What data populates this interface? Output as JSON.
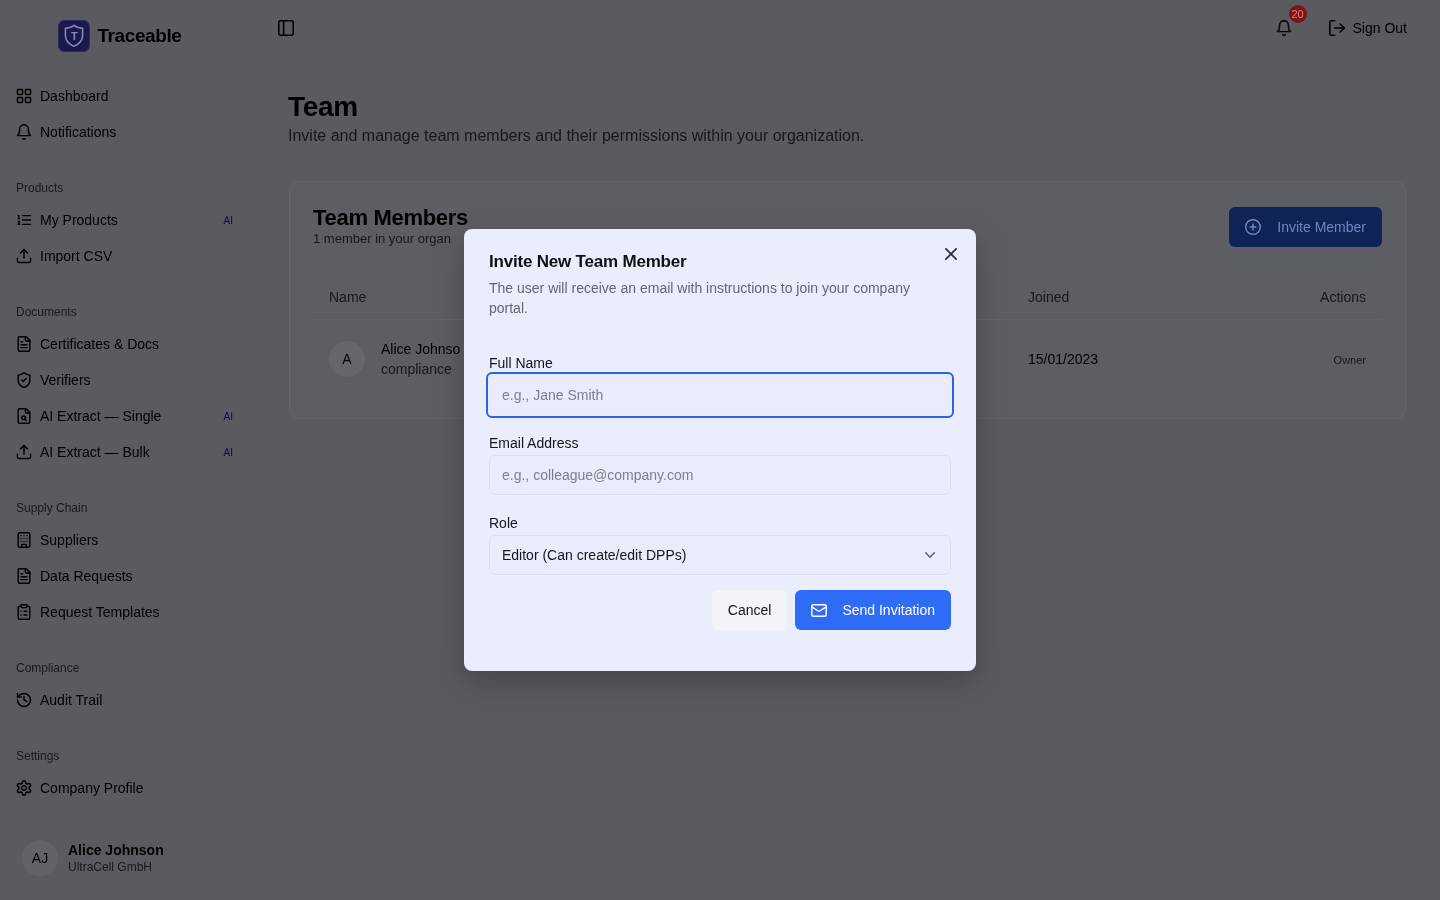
{
  "sidebar": {
    "brand": {
      "mark": "T",
      "name": "Traceable"
    },
    "nav": [
      {
        "label": "Dashboard"
      },
      {
        "label": "Notifications"
      }
    ],
    "sections": [
      {
        "title": "Products",
        "items": [
          {
            "label": "My Products",
            "badge": "AI"
          },
          {
            "label": "Import CSV"
          }
        ]
      },
      {
        "title": "Documents",
        "items": [
          {
            "label": "Certificates & Docs"
          },
          {
            "label": "Verifiers"
          },
          {
            "label": "AI Extract — Single",
            "badge": "AI"
          },
          {
            "label": "AI Extract — Bulk",
            "badge": "AI"
          }
        ]
      },
      {
        "title": "Supply Chain",
        "items": [
          {
            "label": "Suppliers"
          },
          {
            "label": "Data Requests"
          },
          {
            "label": "Request Templates"
          }
        ]
      },
      {
        "title": "Compliance",
        "items": [
          {
            "label": "Audit Trail"
          }
        ]
      },
      {
        "title": "Settings",
        "items": [
          {
            "label": "Company Profile"
          }
        ]
      }
    ],
    "user": {
      "initials": "AJ",
      "name": "Alice Johnson",
      "company": "UltraCell GmbH"
    }
  },
  "topbar": {
    "notification_count": "20",
    "sign_out": "Sign Out"
  },
  "page": {
    "title": "Team",
    "subtitle": "Invite and manage team members and their permissions within your organization."
  },
  "team_card": {
    "title": "Team Members",
    "subtitle": "1 member in your organ",
    "invite_button": "Invite Member",
    "table": {
      "columns": [
        "Name",
        "Joined",
        "Actions"
      ],
      "rows": [
        {
          "initial": "A",
          "name": "Alice Johnso",
          "email": "compliance",
          "joined": "15/01/2023",
          "action": "Owner"
        }
      ]
    }
  },
  "dialog": {
    "title": "Invite New Team Member",
    "description": "The user will receive an email with instructions to join your company portal.",
    "fields": [
      {
        "kind": "text",
        "label": "Full Name",
        "placeholder": "e.g., Jane Smith",
        "focused": true
      },
      {
        "kind": "text",
        "label": "Email Address",
        "placeholder": "e.g., colleague@company.com",
        "focused": false
      },
      {
        "kind": "select",
        "label": "Role",
        "value": "Editor (Can create/edit DPPs)",
        "focused": false
      }
    ],
    "buttons": [
      {
        "kind": "secondary",
        "label": "Cancel"
      },
      {
        "kind": "primary",
        "label": "Send Invitation"
      }
    ]
  }
}
